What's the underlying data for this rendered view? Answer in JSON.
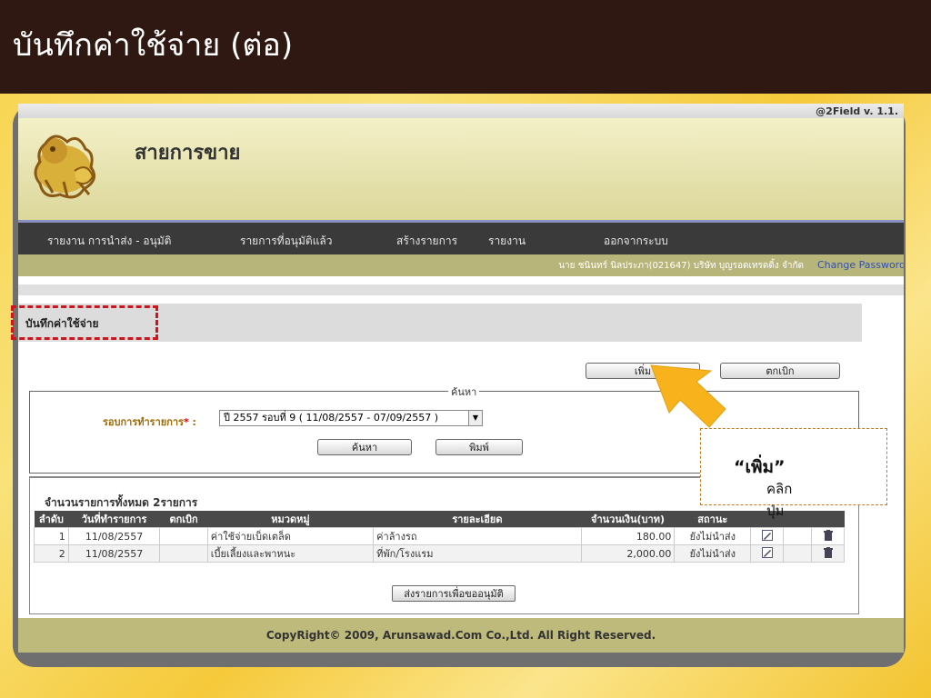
{
  "slide": {
    "title": "บันทึกค่าใช้จ่าย (ต่อ)"
  },
  "app": {
    "version": "@2Field v. 1.1.",
    "title": "สายการขาย",
    "nav": [
      "รายงาน การนำส่ง - อนุมัติ",
      "รายการที่อนุมัติแล้ว",
      "สร้างรายการ",
      "รายงาน",
      "ออกจากระบบ"
    ],
    "user": "นาย ชนินทร์ นิลประภา(021647) บริษัท บุญรอดเทรดดิ้ง จำกัด",
    "change_password": "Change Password",
    "section_title": "บันทึกค่าใช้จ่าย",
    "add_button": "เพิ่ม",
    "withdraw_button": "ตกเบิก",
    "search": {
      "legend": "ค้นหา",
      "round_label": "รอบการทำรายการ",
      "round_star": "*",
      "round_colon": " :",
      "round_value": "ปี 2557 รอบที่ 9 ( 11/08/2557 - 07/09/2557 )",
      "search_button": "ค้นหา",
      "print_button": "พิมพ์"
    },
    "list": {
      "count_label": "จำนวนรายการทั้งหมด",
      "count_value": "2",
      "count_unit": "รายการ",
      "columns": [
        "ลำดับ",
        "วันที่ทำรายการ",
        "ตกเบิก",
        "หมวดหมู่",
        "รายละเอียด",
        "จำนวนเงิน(บาท)",
        "สถานะ",
        "",
        "",
        ""
      ],
      "rows": [
        {
          "no": "1",
          "date": "11/08/2557",
          "withdraw": "",
          "category": "ค่าใช้จ่ายเบ็ดเตล็ด",
          "detail": "ค่าล้างรถ",
          "amount": "180.00",
          "status": "ยังไม่นำส่ง"
        },
        {
          "no": "2",
          "date": "11/08/2557",
          "withdraw": "",
          "category": "เบี้ยเลี้ยงและพาหนะ",
          "detail": "ที่พัก/โรงแรม",
          "amount": "2,000.00",
          "status": "ยังไม่นำส่ง"
        }
      ],
      "submit_button": "ส่งรายการเพื่อขออนุมัติ"
    },
    "footer": "CopyRight© 2009, Arunsawad.Com Co.,Ltd. All Right Reserved."
  },
  "callout": {
    "prefix": "คลิกปุ่ม ",
    "emphasis": "“เพิ่ม”"
  },
  "colors": {
    "title_bar": "#2f1811",
    "arrow": "#f7b21c",
    "highlight": "#d0141c"
  }
}
